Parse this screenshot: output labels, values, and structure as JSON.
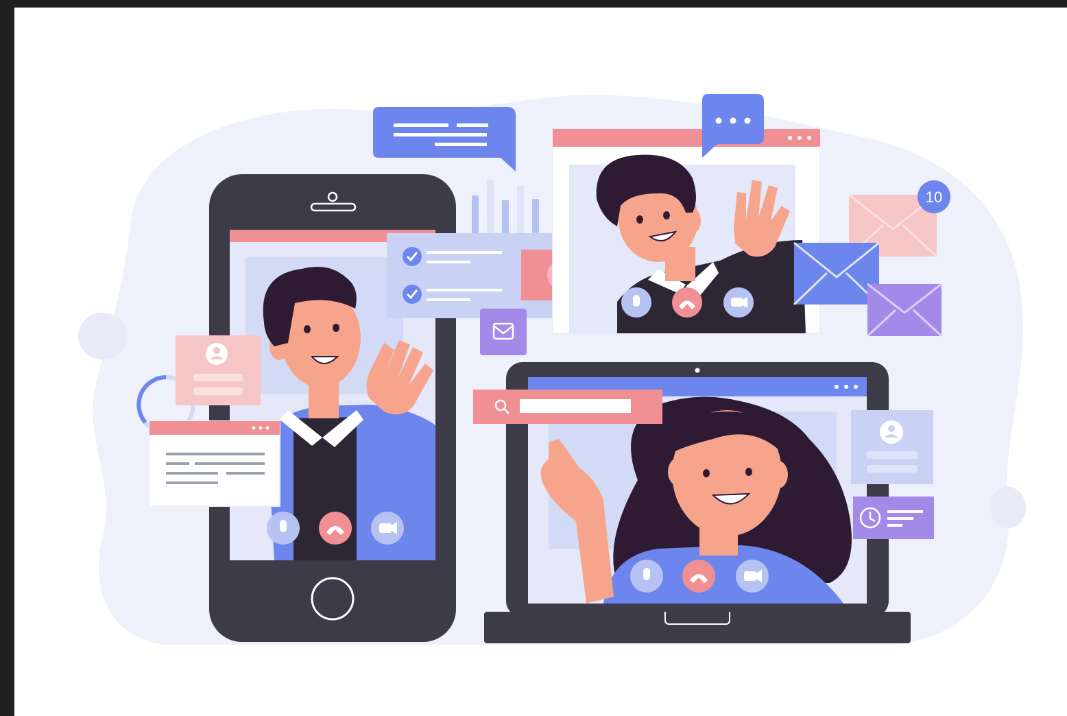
{
  "illustration": {
    "notification_count": "10",
    "colors": {
      "frame_bg": "#1f1f1f",
      "canvas_bg": "#ffffff",
      "blob": "#eef0fb",
      "device_dark": "#3d3b47",
      "screen_light": "#e4e8f9",
      "blue": "#6c86ee",
      "pink": "#f08f94",
      "pink_light": "#f6c6c6",
      "purple": "#a48ae8",
      "hair": "#2e1b33",
      "skin": "#f6a58c",
      "shirt_dark": "#2d2634"
    },
    "icons": [
      "microphone-icon",
      "hang-up-icon",
      "camera-icon",
      "search-icon",
      "play-icon",
      "mail-icon",
      "clock-icon",
      "user-icon",
      "check-icon",
      "chat-dots-icon",
      "home-button-icon"
    ]
  }
}
